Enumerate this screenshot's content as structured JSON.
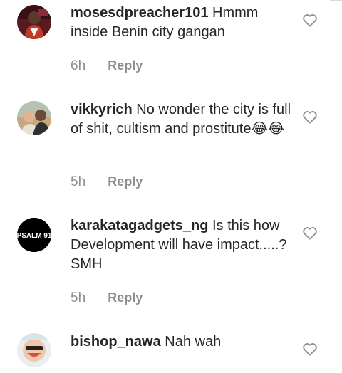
{
  "comments": [
    {
      "username": "mosesdpreacher101",
      "text": "Hmmm inside Benin city gangan",
      "time": "6h",
      "reply_label": "Reply",
      "avatar": "profile-photo"
    },
    {
      "username": "vikkyrich",
      "text": "No wonder the city is full of shit, cultism and prostitute😂😂",
      "time": "5h",
      "reply_label": "Reply",
      "avatar": "profile-photo"
    },
    {
      "username": "karakatagadgets_ng",
      "text": "Is this how Development will have impact.....? SMH",
      "time": "5h",
      "reply_label": "Reply",
      "avatar": "psalm-91-logo",
      "avatar_text": "PSALM 91"
    },
    {
      "username": "bishop_nawa",
      "text": "Nah wah",
      "avatar": "profile-photo"
    }
  ],
  "icons": {
    "like": "heart-outline-icon"
  },
  "colors": {
    "text": "#262626",
    "meta": "#8e8e8e",
    "heart": "#8e8e8e"
  }
}
